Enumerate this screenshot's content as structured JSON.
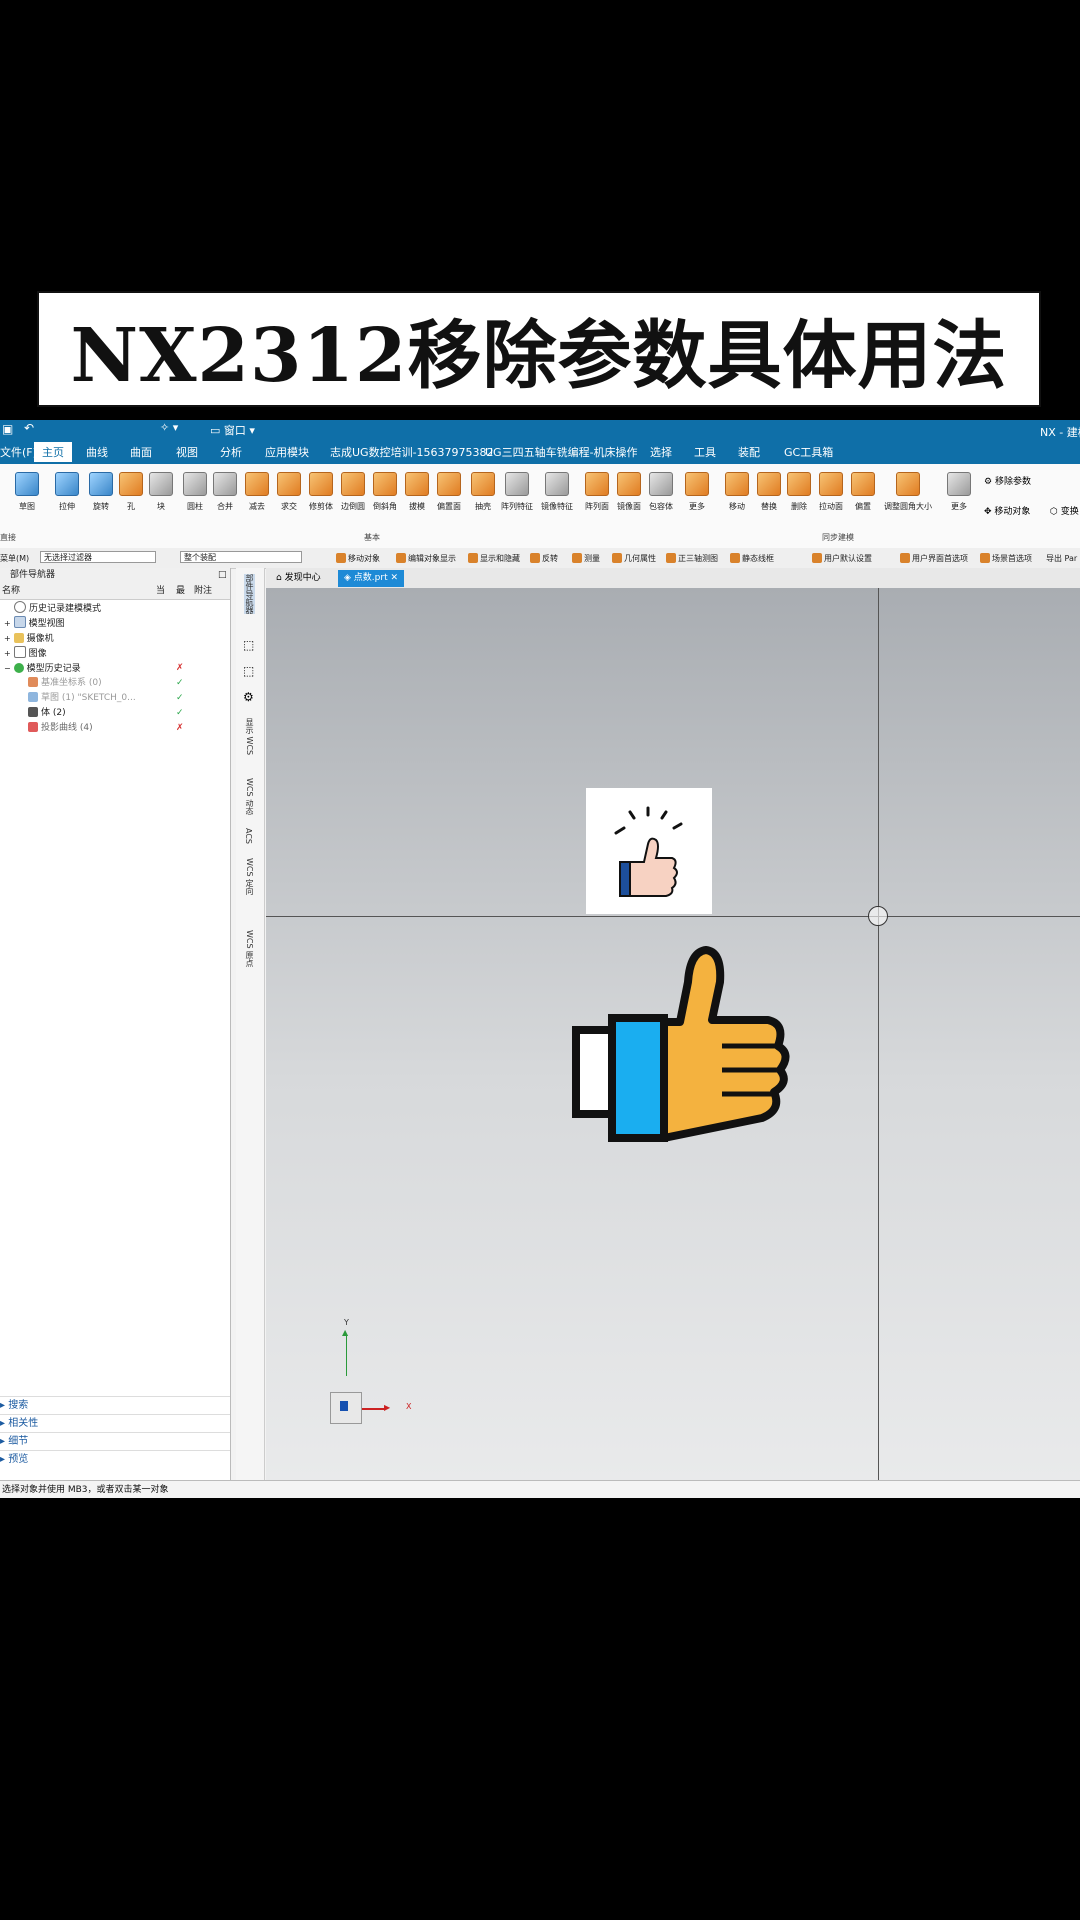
{
  "banner": {
    "title": "NX2312移除参数具体用法"
  },
  "app": {
    "title_right": "NX - 建模",
    "menu": [
      "文件(F)",
      "主页",
      "曲线",
      "曲面",
      "视图",
      "分析",
      "应用模块",
      "志成UG数控培训-15637975382",
      "UG三四五轴车铣编程-机床操作",
      "选择",
      "工具",
      "装配",
      "GC工具箱"
    ],
    "ribbon": {
      "basic_buttons": [
        "草图",
        "拉伸",
        "旋转",
        "孔",
        "块",
        "圆柱",
        "合并",
        "减去",
        "求交",
        "修剪体",
        "边倒圆",
        "倒斜角",
        "拔模",
        "偏置面",
        "抽壳",
        "阵列特征",
        "镜像特征",
        "阵列面",
        "镜像面",
        "包容体",
        "更多"
      ],
      "sync_buttons": [
        "移动",
        "替换",
        "删除",
        "拉动面",
        "偏置",
        "调整圆角大小",
        "更多"
      ],
      "right_buttons": [
        "移除参数",
        "移动对象",
        "变换"
      ],
      "group_basic": "基本",
      "group_sync": "同步建模",
      "group_left": "直接"
    },
    "filterbar": {
      "menu_short": "菜单(M)",
      "type_filter": "无选择过滤器",
      "assembly_filter": "整个装配",
      "items": [
        "移动对象",
        "编辑对象显示",
        "显示和隐藏",
        "反转",
        "测量",
        "几何属性",
        "正三轴测图",
        "静态线框",
        "用户默认设置",
        "用户界面首选项",
        "场景首选项",
        "导出 Par"
      ]
    },
    "navigator": {
      "title": "部件导航器",
      "columns": [
        "名称",
        "当",
        "最",
        "附注"
      ],
      "tree": [
        {
          "label": "历史记录建模模式"
        },
        {
          "label": "模型视图"
        },
        {
          "label": "摄像机"
        },
        {
          "label": "图像"
        },
        {
          "label": "模型历史记录"
        },
        {
          "label": "基准坐标系 (0)"
        },
        {
          "label": "草图 (1) \"SKETCH_0..."
        },
        {
          "label": "体 (2)"
        },
        {
          "label": "投影曲线 (4)"
        }
      ],
      "accordions": [
        "搜索",
        "相关性",
        "细节",
        "预览"
      ]
    },
    "resource_bar": [
      "部件导航器",
      "显示 WCS",
      "WCS 动态",
      "ACS",
      "WCS 定向",
      "WCS 原点"
    ],
    "tabs": [
      "发现中心",
      "点数.prt"
    ],
    "axes": {
      "x": "X",
      "y": "Y"
    },
    "status": "选择对象并使用 MB3，或者双击某一对象"
  }
}
